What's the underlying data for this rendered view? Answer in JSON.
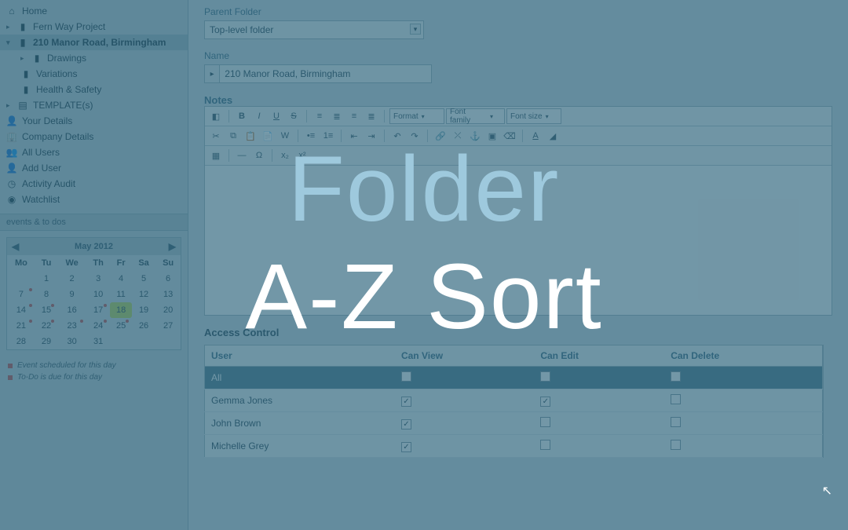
{
  "overlay": {
    "line1": "Folder",
    "line2": "A-Z Sort"
  },
  "sidebar": {
    "items": [
      {
        "label": "Home",
        "icon": "home"
      },
      {
        "label": "Fern Way Project",
        "icon": "folder"
      },
      {
        "label": "210 Manor Road, Birmingham",
        "icon": "folder-open"
      },
      {
        "label": "Drawings",
        "icon": "folder"
      },
      {
        "label": "Variations",
        "icon": "folder"
      },
      {
        "label": "Health & Safety",
        "icon": "folder"
      },
      {
        "label": "TEMPLATE(s)",
        "icon": "template"
      },
      {
        "label": "Your Details",
        "icon": "user"
      },
      {
        "label": "Company Details",
        "icon": "company"
      },
      {
        "label": "All Users",
        "icon": "users"
      },
      {
        "label": "Add User",
        "icon": "user-add"
      },
      {
        "label": "Activity Audit",
        "icon": "clock"
      },
      {
        "label": "Watchlist",
        "icon": "eye"
      }
    ],
    "events_header": "events & to dos",
    "calendar": {
      "title": "May 2012",
      "days": [
        "Mo",
        "Tu",
        "We",
        "Th",
        "Fr",
        "Sa",
        "Su"
      ],
      "weeks": [
        [
          "",
          "1",
          "2",
          "3",
          "4",
          "5",
          "6"
        ],
        [
          "7",
          "8",
          "9",
          "10",
          "11",
          "12",
          "13"
        ],
        [
          "14",
          "15",
          "16",
          "17",
          "18",
          "19",
          "20"
        ],
        [
          "21",
          "22",
          "23",
          "24",
          "25",
          "26",
          "27"
        ],
        [
          "28",
          "29",
          "30",
          "31",
          "",
          "",
          ""
        ]
      ],
      "today": "18"
    },
    "legend": {
      "event": "Event scheduled for this day",
      "todo": "To-Do is due for this day"
    }
  },
  "form": {
    "parent_label": "Parent Folder",
    "parent_value": "Top-level folder",
    "name_label": "Name",
    "name_value": "210 Manor Road, Birmingham",
    "notes_label": "Notes"
  },
  "editor": {
    "format": "Format",
    "font_family": "Font family",
    "font_size": "Font size"
  },
  "access": {
    "title": "Access Control",
    "headers": [
      "User",
      "Can View",
      "Can Edit",
      "Can Delete"
    ],
    "rows": [
      {
        "user": "All",
        "view": false,
        "edit": false,
        "del": false,
        "hl": true
      },
      {
        "user": "Gemma Jones",
        "view": true,
        "edit": true,
        "del": false
      },
      {
        "user": "John Brown",
        "view": true,
        "edit": false,
        "del": false
      },
      {
        "user": "Michelle Grey",
        "view": true,
        "edit": false,
        "del": false
      }
    ]
  }
}
